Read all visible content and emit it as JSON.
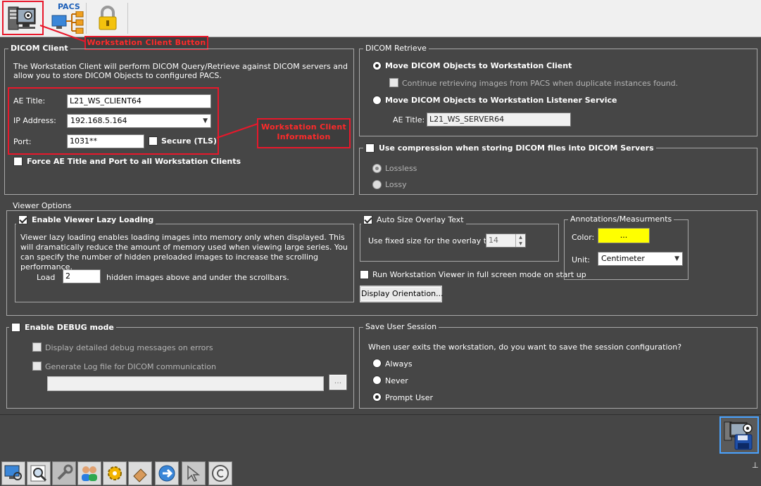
{
  "toolbar": {
    "pacs_label": "PACS"
  },
  "annotations": {
    "workstation_client_button": "Workstation Client Button",
    "workstation_client_information": "Workstation Client Information"
  },
  "dicom_client": {
    "legend": "DICOM Client",
    "description": "The Workstation Client will perform DICOM Query/Retrieve against DICOM servers and allow you to store DICOM Objects to configured PACS.",
    "ae_title_label": "AE Title:",
    "ae_title_value": "L21_WS_CLIENT64",
    "ip_label": "IP Address:",
    "ip_value": "192.168.5.164",
    "port_label": "Port:",
    "port_value": "1031**",
    "secure_label": "Secure (TLS)",
    "force_label": "Force AE Title and Port to all Workstation Clients"
  },
  "dicom_retrieve": {
    "legend": "DICOM Retrieve",
    "move_client_label": "Move DICOM Objects to Workstation Client",
    "continue_label": "Continue retrieving images from PACS when duplicate instances found.",
    "move_listener_label": "Move DICOM Objects to Workstation Listener Service",
    "ae_title_label": "AE Title:",
    "ae_title_value": "L21_WS_SERVER64"
  },
  "compression": {
    "legend": "Use compression when storing DICOM files into DICOM Servers",
    "lossless_label": "Lossless",
    "lossy_label": "Lossy"
  },
  "viewer_options": {
    "legend": "Viewer Options",
    "lazy_legend": "Enable Viewer Lazy Loading",
    "lazy_description": "Viewer lazy loading enables loading images into memory only when displayed. This will dramatically reduce the amount of memory used when viewing large series. You can specify the number of hidden preloaded images to increase the scrolling performance.",
    "load_label": "Load",
    "load_value": "2",
    "hidden_label": "hidden images above and under the scrollbars.",
    "auto_size_legend": "Auto Size Overlay Text",
    "fixed_size_label": "Use fixed size for the overlay text:",
    "fixed_size_value": "14",
    "fullscreen_label": "Run Workstation Viewer in full screen mode on start up",
    "display_orientation_label": "Display Orientation...",
    "annotations_legend": "Annotations/Measurments",
    "color_label": "Color:",
    "color_button_label": "...",
    "color_value": "#ffff00",
    "unit_label": "Unit:",
    "unit_value": "Centimeter"
  },
  "debug": {
    "legend": "Enable DEBUG mode",
    "detailed_label": "Display detailed debug messages on errors",
    "log_label": "Generate Log file for DICOM communication",
    "log_path_value": "",
    "browse_label": "..."
  },
  "session": {
    "legend": "Save User Session",
    "question": "When user exits the workstation, do you want to save the session configuration?",
    "always_label": "Always",
    "never_label": "Never",
    "prompt_label": "Prompt User"
  },
  "colors": {
    "annotation_red": "#e8182b",
    "panel_bg": "#464646"
  }
}
